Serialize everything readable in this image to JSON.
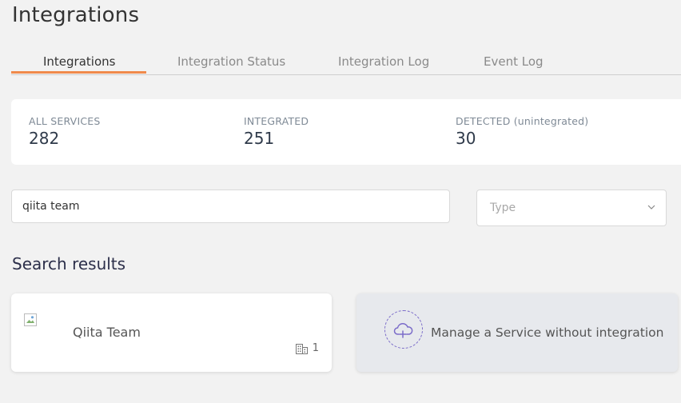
{
  "page": {
    "title": "Integrations"
  },
  "tabs": [
    {
      "label": "Integrations",
      "active": true
    },
    {
      "label": "Integration Status",
      "active": false
    },
    {
      "label": "Integration Log",
      "active": false
    },
    {
      "label": "Event Log",
      "active": false
    }
  ],
  "stats": [
    {
      "label": "ALL SERVICES",
      "value": "282"
    },
    {
      "label": "INTEGRATED",
      "value": "251"
    },
    {
      "label": "DETECTED (unintegrated)",
      "value": "30"
    }
  ],
  "search": {
    "value": "qiita team"
  },
  "type_filter": {
    "placeholder": "Type"
  },
  "results": {
    "title": "Search results",
    "items": [
      {
        "name": "Qiita Team",
        "org_count": "1",
        "icon": "building-icon"
      }
    ]
  },
  "manage": {
    "label": "Manage a Service without integration",
    "icon": "cloud-plus-icon"
  },
  "colors": {
    "accent": "#f08a4b",
    "purple": "#7b6cc9"
  }
}
